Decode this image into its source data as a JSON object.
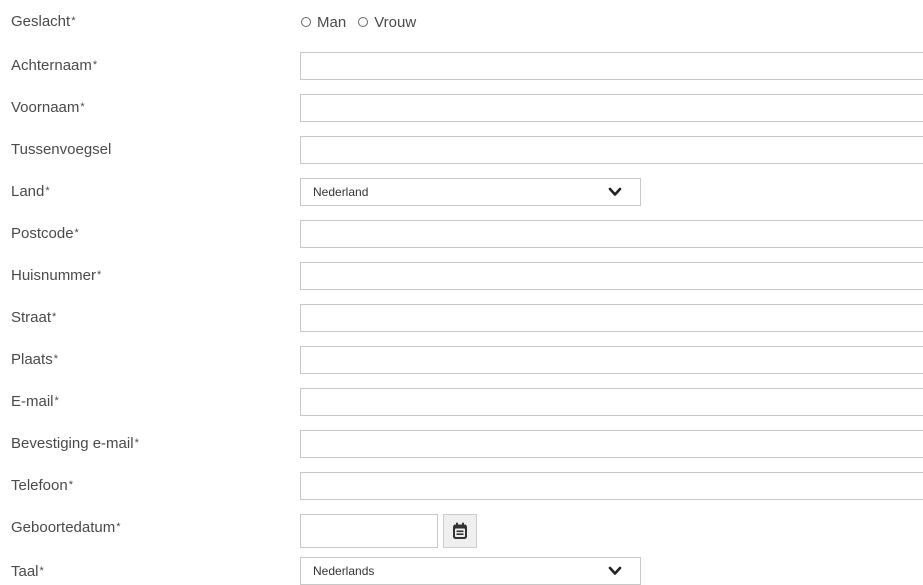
{
  "form": {
    "gender": {
      "label": "Geslacht",
      "options": [
        "Man",
        "Vrouw"
      ]
    },
    "fields": [
      {
        "key": "achternaam",
        "label": "Achternaam",
        "value": ""
      },
      {
        "key": "voornaam",
        "label": "Voornaam",
        "value": ""
      },
      {
        "key": "tussenvoegsel",
        "label": "Tussenvoegsel",
        "value": ""
      },
      {
        "key": "land",
        "label": "Land",
        "value": "Nederland"
      },
      {
        "key": "postcode",
        "label": "Postcode",
        "value": ""
      },
      {
        "key": "huisnummer",
        "label": "Huisnummer",
        "value": ""
      },
      {
        "key": "straat",
        "label": "Straat",
        "value": ""
      },
      {
        "key": "plaats",
        "label": "Plaats",
        "value": ""
      },
      {
        "key": "email",
        "label": "E-mail",
        "value": ""
      },
      {
        "key": "bevestiging_email",
        "label": "Bevestiging e-mail",
        "value": ""
      },
      {
        "key": "telefoon",
        "label": "Telefoon",
        "value": ""
      },
      {
        "key": "geboortedatum",
        "label": "Geboortedatum",
        "value": ""
      },
      {
        "key": "taal",
        "label": "Taal",
        "value": "Nederlands"
      }
    ],
    "required_marker": "*",
    "icons": {
      "select_arrow": "chevron-down-icon",
      "date_picker": "calendar-icon"
    }
  }
}
